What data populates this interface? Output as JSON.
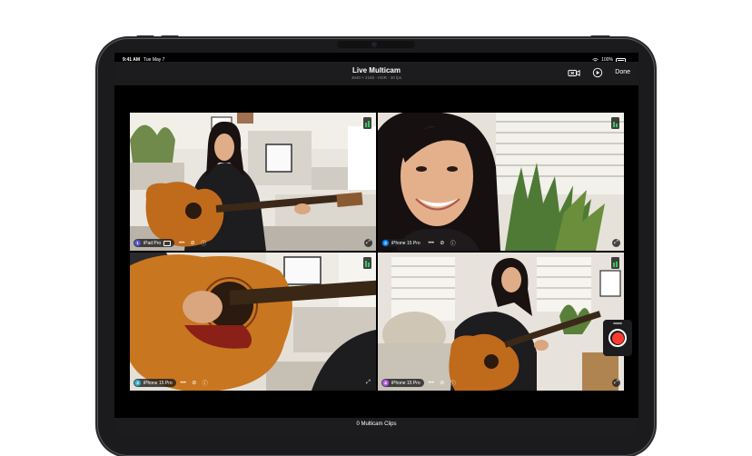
{
  "status_bar": {
    "time": "9:41 AM",
    "date": "Tue May 7",
    "battery": "100%"
  },
  "header": {
    "title": "Live Multicam",
    "subtitle": "3840 × 2160 - HDR - 30 fps",
    "done_label": "Done",
    "icons": [
      "camera-switch-icon",
      "playback-icon"
    ]
  },
  "cameras": [
    {
      "number": "1",
      "label": "iPad Pro",
      "color": "#5856d6"
    },
    {
      "number": "2",
      "label": "iPhone 15 Pro",
      "color": "#0a84ff"
    },
    {
      "number": "3",
      "label": "iPhone 15 Pro",
      "color": "#30b0c7"
    },
    {
      "number": "4",
      "label": "iPhone 15 Pro",
      "color": "#bf5af2"
    }
  ],
  "footer": {
    "clips_label": "0 Multicam Clips"
  },
  "colors": {
    "record": "#ff3b30",
    "audio_level": "#34c759",
    "background": "#000000"
  }
}
